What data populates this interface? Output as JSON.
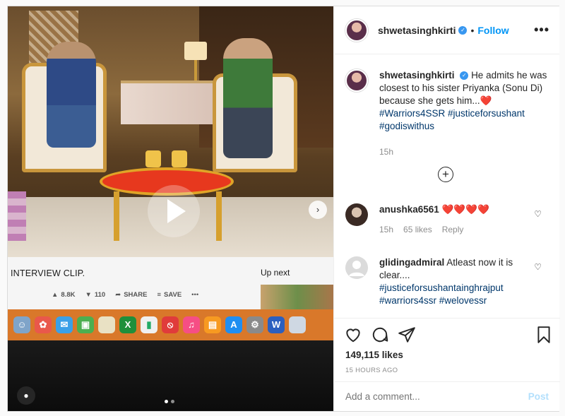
{
  "post": {
    "username": "shwetasinghkirti",
    "follow_label": "Follow",
    "separator": "•",
    "more_label": "•••",
    "caption": {
      "username": "shwetasinghkirti",
      "text": "He admits he was closest to his sister Priyanka (Sonu Di) because she gets him...",
      "emoji": "❤️",
      "hashtags": [
        "#Warriors4SSR",
        "#justiceforsushant",
        "#godiswithus"
      ],
      "time": "15h"
    },
    "load_more_label": "+",
    "comments": [
      {
        "username": "anushka6561",
        "text": "❤️❤️❤️❤️",
        "time": "15h",
        "likes": "65 likes",
        "reply_label": "Reply"
      },
      {
        "username": "glidingadmiral",
        "text": "Atleast now it is clear....",
        "hashtags": [
          "#justiceforsushantainghrajput",
          "#warriors4ssr",
          "#welovessr"
        ]
      }
    ],
    "likes_count": "149,115 likes",
    "posted_ago": "15 HOURS AGO",
    "comment_placeholder": "Add a comment...",
    "post_label": "Post"
  },
  "media": {
    "video_title": "INTERVIEW CLIP.",
    "up_next": "Up next",
    "likes": "8.8K",
    "dislikes": "110",
    "share": "SHARE",
    "save": "SAVE",
    "more": "•••",
    "carousel_dots": 2
  },
  "colors": {
    "accent": "#0095f6",
    "heart": "#ed4956",
    "hashtag": "#00376b",
    "muted": "#8e8e8e"
  }
}
